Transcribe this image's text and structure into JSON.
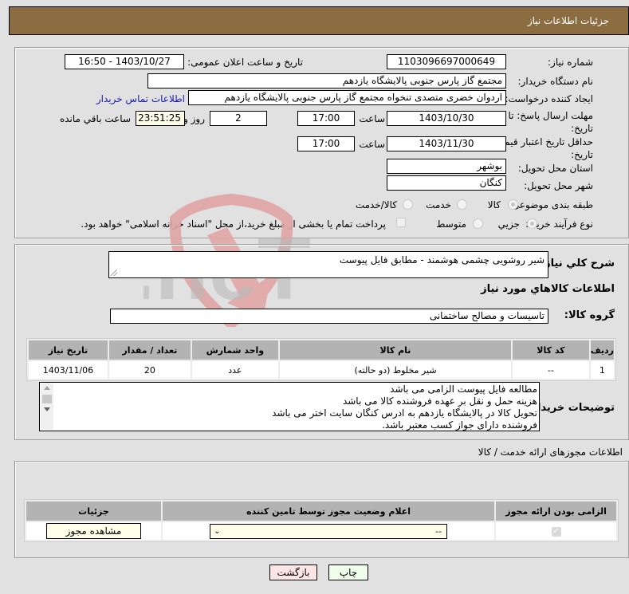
{
  "header": {
    "title": "جزئیات اطلاعات نیاز"
  },
  "form": {
    "need_number": {
      "label": "شماره نیاز:",
      "value": "1103096697000649"
    },
    "announce_datetime": {
      "label": "تاریخ و ساعت اعلان عمومی:",
      "value": "1403/10/27 - 16:50"
    },
    "buyer_org": {
      "label": "نام دستگاه خریدار:",
      "value": "مجتمع گاز پارس جنوبی  پالایشگاه یازدهم"
    },
    "requester": {
      "label": "ایجاد کننده درخواست:",
      "value": "اردوان خضری متصدی تنخواه مجتمع گاز پارس جنوبی  پالایشگاه یازدهم"
    },
    "buyer_contact_link": "اطلاعات تماس خریدار",
    "response_deadline": {
      "label": "مهلت ارسال پاسخ: تا تاریخ:",
      "date": "1403/10/30",
      "time_label": "ساعت",
      "time": "17:00",
      "days": "2",
      "days_label": "روز و",
      "remaining": "23:51:25",
      "remaining_label": "ساعت باقي مانده"
    },
    "price_validity": {
      "label": "حداقل تاریخ اعتبار قیمت: تا تاریخ:",
      "date": "1403/11/30",
      "time_label": "ساعت",
      "time": "17:00"
    },
    "delivery_province": {
      "label": "استان محل تحویل:",
      "value": "بوشهر"
    },
    "delivery_city": {
      "label": "شهر محل تحویل:",
      "value": "کنگان"
    },
    "category": {
      "label": "طبقه بندی موضوعی:",
      "options": [
        "کالا",
        "خدمت",
        "کالا/خدمت"
      ],
      "selected": "کالا"
    },
    "purchase_type": {
      "label": "نوع فرآیند خرید :",
      "options": [
        "جزیي",
        "متوسط"
      ],
      "selected": "جزیي",
      "treasury_note": "پرداخت تمام یا بخشی از مبلغ خرید،از محل \"اسناد خزانه اسلامی\" خواهد بود.",
      "treasury_checked": false
    }
  },
  "description": {
    "label": "شرح کلي نياز:",
    "value": "شیر روشویی چشمی هوشمند - مطابق فایل پیوست"
  },
  "goods_section_title": "اطلاعات کالاهاي مورد نياز",
  "goods_group": {
    "label": "گروه کالا:",
    "value": "تاسیسات و مصالح ساختمانی"
  },
  "goods_table": {
    "headers": [
      "ردیف",
      "کد کالا",
      "نام کالا",
      "واحد شمارش",
      "تعداد / مقدار",
      "تاریخ نیاز"
    ],
    "rows": [
      [
        "1",
        "--",
        "شیر مخلوط (دو حالته)",
        "عدد",
        "20",
        "1403/11/06"
      ]
    ]
  },
  "buyer_notes": {
    "label": "توضیحات خریدار:",
    "lines": [
      "مطالعه فایل پیوست الزامی می باشد",
      "هزینه حمل و نقل بر عهده فروشنده کالا می باشد",
      "تحویل کالا در پالایشگاه یازدهم به ادرس کنگان سایت اختر می باشد",
      "فروشنده دارای جواز کسب معتبر باشد."
    ]
  },
  "permits": {
    "title": "اطلاعات مجوزهای ارائه خدمت / کالا",
    "headers": [
      "الزامی بودن ارائه مجوز",
      "اعلام وضعیت مجوز توسط تامین کننده",
      "جزئیات"
    ],
    "row": {
      "required_checked": true,
      "status_value": "--",
      "view_button": "مشاهده مجوز"
    }
  },
  "footer": {
    "print_button": "چاپ",
    "back_button": "بازگشت"
  },
  "watermark": {
    "text": "AriaTender.neT"
  }
}
